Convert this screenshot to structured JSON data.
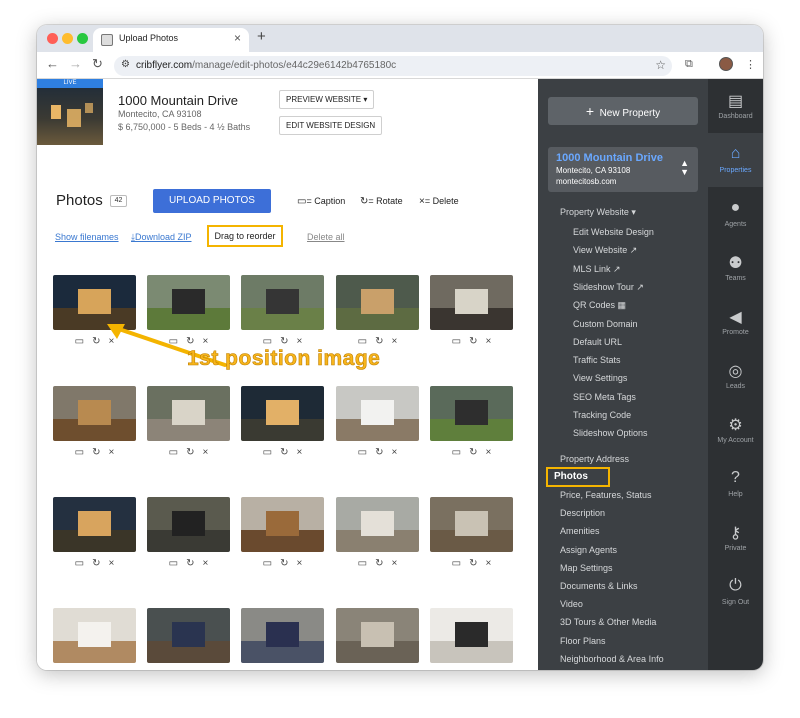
{
  "browser": {
    "tab_title": "Upload Photos",
    "url_domain": "cribflyer.com",
    "url_path": "/manage/edit-photos/e44c29e6142b4765180c"
  },
  "property_header": {
    "live_badge": "LIVE",
    "address": "1000 Mountain Drive",
    "city": "Montecito, CA 93108",
    "price_details": "$ 6,750,000 - 5 Beds - 4 ½ Baths",
    "preview_button": "PREVIEW WEBSITE",
    "edit_design_button": "EDIT WEBSITE DESIGN"
  },
  "photos": {
    "title": "Photos",
    "count": "42",
    "upload_button": "UPLOAD PHOTOS",
    "legend_caption": "= Caption",
    "legend_rotate": "= Rotate",
    "legend_delete": "= Delete",
    "show_filenames": "Show filenames",
    "download_zip": "Download ZIP",
    "drag_to_reorder": "Drag to reorder",
    "delete_all": "Delete all",
    "callout": "1st position image"
  },
  "thumbnails": [
    {
      "top": "#1b2a3c",
      "bottom": "#4a3a25",
      "accent": "#d7a45a"
    },
    {
      "top": "#7b8a72",
      "bottom": "#5d7a3a",
      "accent": "#2a2a2a"
    },
    {
      "top": "#6d7b66",
      "bottom": "#6a8048",
      "accent": "#353535"
    },
    {
      "top": "#4e5a4c",
      "bottom": "#5d6b42",
      "accent": "#c9a06a"
    },
    {
      "top": "#6f6a60",
      "bottom": "#3a3530",
      "accent": "#d8d4c8"
    },
    {
      "top": "#80786a",
      "bottom": "#6e4e2e",
      "accent": "#b88a50"
    },
    {
      "top": "#6a7060",
      "bottom": "#8c8478",
      "accent": "#d9d4c8"
    },
    {
      "top": "#1e2a36",
      "bottom": "#3a3a32",
      "accent": "#e2b067"
    },
    {
      "top": "#c8c8c4",
      "bottom": "#8a7a66",
      "accent": "#f2f2f0"
    },
    {
      "top": "#5a6a5a",
      "bottom": "#5f7f3c",
      "accent": "#2e2e2e"
    },
    {
      "top": "#243040",
      "bottom": "#3a3528",
      "accent": "#d8a45e"
    },
    {
      "top": "#5a5a4e",
      "bottom": "#3a3a34",
      "accent": "#222222"
    },
    {
      "top": "#b8b0a4",
      "bottom": "#6a4a2e",
      "accent": "#9a6a3a"
    },
    {
      "top": "#a8aaa4",
      "bottom": "#8a8070",
      "accent": "#e4e0d8"
    },
    {
      "top": "#7a7060",
      "bottom": "#6a5a46",
      "accent": "#c9c2b4"
    },
    {
      "top": "#e0dcd4",
      "bottom": "#b08a62",
      "accent": "#f4f2ee"
    },
    {
      "top": "#4a5050",
      "bottom": "#5a4a3a",
      "accent": "#2a3450"
    },
    {
      "top": "#8a8a86",
      "bottom": "#4a5266",
      "accent": "#2a3050"
    },
    {
      "top": "#8a8478",
      "bottom": "#6a6256",
      "accent": "#c8c0b2"
    },
    {
      "top": "#eceae6",
      "bottom": "#c8c4bc",
      "accent": "#2a2a2a"
    }
  ],
  "sidebar": {
    "new_property": "New Property",
    "property_name": "1000 Mountain Drive",
    "property_city": "Montecito, CA 93108",
    "property_domain": "montecitosb.com",
    "property_website": "Property Website",
    "sub_items": [
      "Edit Website Design",
      "View Website",
      "MLS Link",
      "Slideshow Tour",
      "QR Codes",
      "Custom Domain",
      "Default URL",
      "Traffic Stats",
      "View Settings",
      "SEO Meta Tags",
      "Tracking Code",
      "Slideshow Options"
    ],
    "property_address": "Property Address",
    "photos": "Photos",
    "main_items": [
      "Price, Features, Status",
      "Description",
      "Amenities",
      "Assign Agents",
      "Map Settings",
      "Documents & Links",
      "Video",
      "3D Tours & Other Media",
      "Floor Plans",
      "Neighborhood & Area Info"
    ]
  },
  "iconbar": [
    {
      "label": "Dashboard",
      "icon": "dashboard-icon"
    },
    {
      "label": "Properties",
      "icon": "properties-icon"
    },
    {
      "label": "Agents",
      "icon": "agent-icon"
    },
    {
      "label": "Teams",
      "icon": "teams-icon"
    },
    {
      "label": "Promote",
      "icon": "megaphone-icon"
    },
    {
      "label": "Leads",
      "icon": "target-icon"
    },
    {
      "label": "My Account",
      "icon": "gear-icon"
    },
    {
      "label": "Help",
      "icon": "help-icon"
    },
    {
      "label": "Private",
      "icon": "key-icon"
    },
    {
      "label": "Sign Out",
      "icon": "power-icon"
    }
  ],
  "colors": {
    "accent_blue": "#3d6fd8",
    "highlight": "#f4b400",
    "sidebar_bg": "#3c4044"
  }
}
